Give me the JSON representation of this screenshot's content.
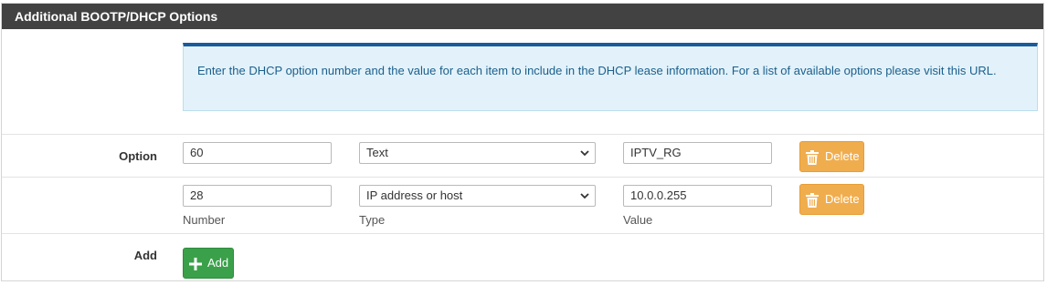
{
  "panel": {
    "title": "Additional BOOTP/DHCP Options"
  },
  "info": {
    "text": "Enter the DHCP option number and the value for each item to include in the DHCP lease information. For a list of available options please visit this",
    "link_text": "URL."
  },
  "rows": [
    {
      "label": "Option",
      "number": "60",
      "type": "Text",
      "value": "IPTV_RG",
      "delete_label": "Delete"
    },
    {
      "label": "",
      "number": "28",
      "type": "IP address or host",
      "value": "10.0.0.255",
      "delete_label": "Delete"
    }
  ],
  "sublabels": {
    "number": "Number",
    "type": "Type",
    "value": "Value"
  },
  "add_row": {
    "label": "Add",
    "button_label": "Add"
  },
  "icons": {
    "delete": "trash-icon",
    "add": "plus-icon",
    "select": "chevron-down-icon"
  },
  "colors": {
    "header_bg": "#424242",
    "info_bg": "#e3f2fa",
    "info_border": "#1a5b9c",
    "delete_btn": "#f0ad4e",
    "add_btn": "#3aa14a"
  }
}
